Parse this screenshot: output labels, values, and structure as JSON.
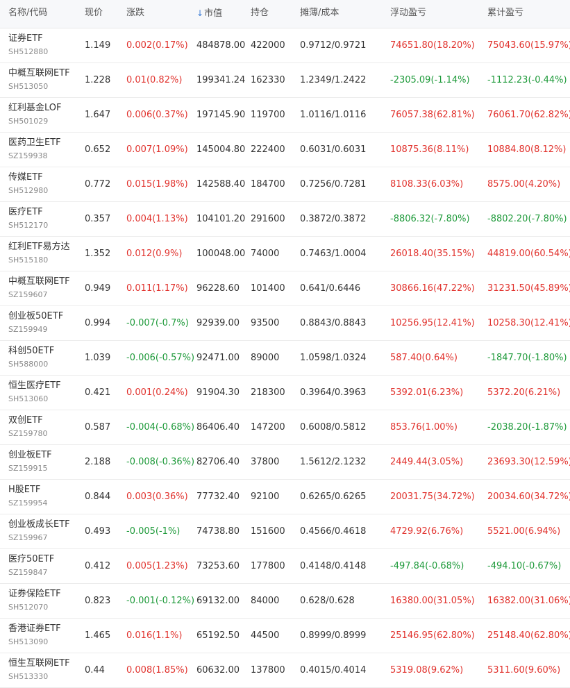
{
  "headers": {
    "name": "名称/代码",
    "price": "现价",
    "change": "涨跌",
    "value": "市值",
    "value_sort_icon": "arrow-down-icon",
    "position": "持仓",
    "cost": "摊薄/成本",
    "float_pnl": "浮动盈亏",
    "total_pnl": "累计盈亏"
  },
  "colors": {
    "up": "#e1322d",
    "down": "#1e9a3a",
    "accent": "#3a7bd5"
  },
  "rows": [
    {
      "name": "证券ETF",
      "code": "SH512880",
      "price": "1.149",
      "change": "0.002(0.17%)",
      "change_dir": "up",
      "value": "484878.00",
      "position": "422000",
      "cost": "0.9712/0.9721",
      "float_pnl": "74651.80(18.20%)",
      "float_dir": "up",
      "total_pnl": "75043.60(15.97%)",
      "total_dir": "up"
    },
    {
      "name": "中概互联网ETF",
      "code": "SH513050",
      "price": "1.228",
      "change": "0.01(0.82%)",
      "change_dir": "up",
      "value": "199341.24",
      "position": "162330",
      "cost": "1.2349/1.2422",
      "float_pnl": "-2305.09(-1.14%)",
      "float_dir": "down",
      "total_pnl": "-1112.23(-0.44%)",
      "total_dir": "down"
    },
    {
      "name": "红利基金LOF",
      "code": "SH501029",
      "price": "1.647",
      "change": "0.006(0.37%)",
      "change_dir": "up",
      "value": "197145.90",
      "position": "119700",
      "cost": "1.0116/1.0116",
      "float_pnl": "76057.38(62.81%)",
      "float_dir": "up",
      "total_pnl": "76061.70(62.82%)",
      "total_dir": "up"
    },
    {
      "name": "医药卫生ETF",
      "code": "SZ159938",
      "price": "0.652",
      "change": "0.007(1.09%)",
      "change_dir": "up",
      "value": "145004.80",
      "position": "222400",
      "cost": "0.6031/0.6031",
      "float_pnl": "10875.36(8.11%)",
      "float_dir": "up",
      "total_pnl": "10884.80(8.12%)",
      "total_dir": "up"
    },
    {
      "name": "传媒ETF",
      "code": "SH512980",
      "price": "0.772",
      "change": "0.015(1.98%)",
      "change_dir": "up",
      "value": "142588.40",
      "position": "184700",
      "cost": "0.7256/0.7281",
      "float_pnl": "8108.33(6.03%)",
      "float_dir": "up",
      "total_pnl": "8575.00(4.20%)",
      "total_dir": "up"
    },
    {
      "name": "医疗ETF",
      "code": "SH512170",
      "price": "0.357",
      "change": "0.004(1.13%)",
      "change_dir": "up",
      "value": "104101.20",
      "position": "291600",
      "cost": "0.3872/0.3872",
      "float_pnl": "-8806.32(-7.80%)",
      "float_dir": "down",
      "total_pnl": "-8802.20(-7.80%)",
      "total_dir": "down"
    },
    {
      "name": "红利ETF易方达",
      "code": "SH515180",
      "price": "1.352",
      "change": "0.012(0.9%)",
      "change_dir": "up",
      "value": "100048.00",
      "position": "74000",
      "cost": "0.7463/1.0004",
      "float_pnl": "26018.40(35.15%)",
      "float_dir": "up",
      "total_pnl": "44819.00(60.54%)",
      "total_dir": "up"
    },
    {
      "name": "中概互联网ETF",
      "code": "SZ159607",
      "price": "0.949",
      "change": "0.011(1.17%)",
      "change_dir": "up",
      "value": "96228.60",
      "position": "101400",
      "cost": "0.641/0.6446",
      "float_pnl": "30866.16(47.22%)",
      "float_dir": "up",
      "total_pnl": "31231.50(45.89%)",
      "total_dir": "up"
    },
    {
      "name": "创业板50ETF",
      "code": "SZ159949",
      "price": "0.994",
      "change": "-0.007(-0.7%)",
      "change_dir": "down",
      "value": "92939.00",
      "position": "93500",
      "cost": "0.8843/0.8843",
      "float_pnl": "10256.95(12.41%)",
      "float_dir": "up",
      "total_pnl": "10258.30(12.41%)",
      "total_dir": "up"
    },
    {
      "name": "科创50ETF",
      "code": "SH588000",
      "price": "1.039",
      "change": "-0.006(-0.57%)",
      "change_dir": "down",
      "value": "92471.00",
      "position": "89000",
      "cost": "1.0598/1.0324",
      "float_pnl": "587.40(0.64%)",
      "float_dir": "up",
      "total_pnl": "-1847.70(-1.80%)",
      "total_dir": "down"
    },
    {
      "name": "恒生医疗ETF",
      "code": "SH513060",
      "price": "0.421",
      "change": "0.001(0.24%)",
      "change_dir": "up",
      "value": "91904.30",
      "position": "218300",
      "cost": "0.3964/0.3963",
      "float_pnl": "5392.01(6.23%)",
      "float_dir": "up",
      "total_pnl": "5372.20(6.21%)",
      "total_dir": "up"
    },
    {
      "name": "双创ETF",
      "code": "SZ159780",
      "price": "0.587",
      "change": "-0.004(-0.68%)",
      "change_dir": "down",
      "value": "86406.40",
      "position": "147200",
      "cost": "0.6008/0.5812",
      "float_pnl": "853.76(1.00%)",
      "float_dir": "up",
      "total_pnl": "-2038.20(-1.87%)",
      "total_dir": "down"
    },
    {
      "name": "创业板ETF",
      "code": "SZ159915",
      "price": "2.188",
      "change": "-0.008(-0.36%)",
      "change_dir": "down",
      "value": "82706.40",
      "position": "37800",
      "cost": "1.5612/2.1232",
      "float_pnl": "2449.44(3.05%)",
      "float_dir": "up",
      "total_pnl": "23693.30(12.59%)",
      "total_dir": "up"
    },
    {
      "name": "H股ETF",
      "code": "SZ159954",
      "price": "0.844",
      "change": "0.003(0.36%)",
      "change_dir": "up",
      "value": "77732.40",
      "position": "92100",
      "cost": "0.6265/0.6265",
      "float_pnl": "20031.75(34.72%)",
      "float_dir": "up",
      "total_pnl": "20034.60(34.72%)",
      "total_dir": "up"
    },
    {
      "name": "创业板成长ETF",
      "code": "SZ159967",
      "price": "0.493",
      "change": "-0.005(-1%)",
      "change_dir": "down",
      "value": "74738.80",
      "position": "151600",
      "cost": "0.4566/0.4618",
      "float_pnl": "4729.92(6.76%)",
      "float_dir": "up",
      "total_pnl": "5521.00(6.94%)",
      "total_dir": "up"
    },
    {
      "name": "医疗50ETF",
      "code": "SZ159847",
      "price": "0.412",
      "change": "0.005(1.23%)",
      "change_dir": "up",
      "value": "73253.60",
      "position": "177800",
      "cost": "0.4148/0.4148",
      "float_pnl": "-497.84(-0.68%)",
      "float_dir": "down",
      "total_pnl": "-494.10(-0.67%)",
      "total_dir": "down"
    },
    {
      "name": "证券保险ETF",
      "code": "SH512070",
      "price": "0.823",
      "change": "-0.001(-0.12%)",
      "change_dir": "down",
      "value": "69132.00",
      "position": "84000",
      "cost": "0.628/0.628",
      "float_pnl": "16380.00(31.05%)",
      "float_dir": "up",
      "total_pnl": "16382.00(31.06%)",
      "total_dir": "up"
    },
    {
      "name": "香港证券ETF",
      "code": "SH513090",
      "price": "1.465",
      "change": "0.016(1.1%)",
      "change_dir": "up",
      "value": "65192.50",
      "position": "44500",
      "cost": "0.8999/0.8999",
      "float_pnl": "25146.95(62.80%)",
      "float_dir": "up",
      "total_pnl": "25148.40(62.80%)",
      "total_dir": "up"
    },
    {
      "name": "恒生互联网ETF",
      "code": "SH513330",
      "price": "0.44",
      "change": "0.008(1.85%)",
      "change_dir": "up",
      "value": "60632.00",
      "position": "137800",
      "cost": "0.4015/0.4014",
      "float_pnl": "5319.08(9.62%)",
      "float_dir": "up",
      "total_pnl": "5311.60(9.60%)",
      "total_dir": "up"
    }
  ]
}
